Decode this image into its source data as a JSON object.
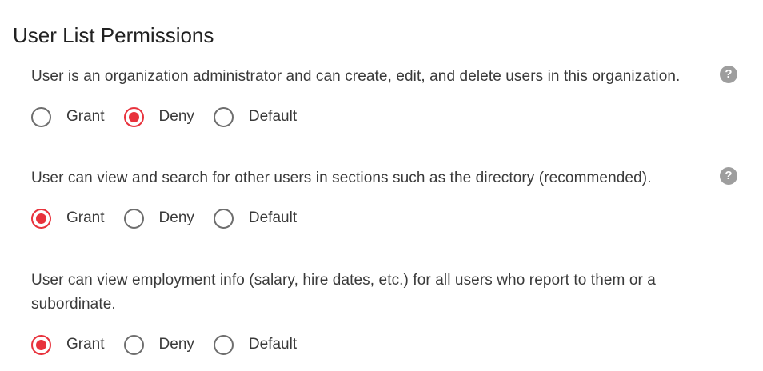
{
  "page": {
    "title": "User List Permissions"
  },
  "colors": {
    "accent": "#e8323c",
    "radio_border": "#6e6e6e",
    "help_icon": "#9e9e9e",
    "text": "#3a3a3a"
  },
  "permissions": [
    {
      "text": "User is an organization administrator and can create, edit, and delete users in this organization.",
      "help_icon": "question-icon",
      "help_glyph": "?",
      "options": [
        "Grant",
        "Deny",
        "Default"
      ],
      "selected": "Deny"
    },
    {
      "text": "User can view and search for other users in sections such as the directory (recommended).",
      "help_icon": "question-icon",
      "help_glyph": "?",
      "options": [
        "Grant",
        "Deny",
        "Default"
      ],
      "selected": "Grant"
    },
    {
      "text": "User can view employment info (salary, hire dates, etc.) for all users who report to them or a subordinate.",
      "options": [
        "Grant",
        "Deny",
        "Default"
      ],
      "selected": "Grant"
    }
  ]
}
